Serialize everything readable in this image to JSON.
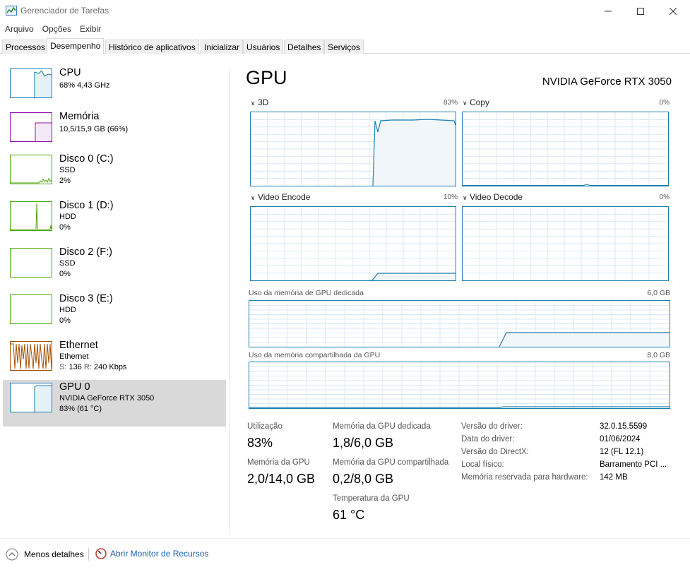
{
  "window": {
    "title": "Gerenciador de Tarefas"
  },
  "menu": [
    "Arquivo",
    "Opções",
    "Exibir"
  ],
  "tabs": [
    "Processos",
    "Desempenho",
    "Histórico de aplicativos",
    "Inicializar",
    "Usuários",
    "Detalhes",
    "Serviços"
  ],
  "sidebar": {
    "items": [
      {
        "name": "CPU",
        "line1": "68% 4,43 GHz",
        "line2": "",
        "color": "#1a7eb0"
      },
      {
        "name": "Memória",
        "line1": "10,5/15,9 GB (66%)",
        "line2": "",
        "color": "#8b12ae"
      },
      {
        "name": "Disco 0 (C:)",
        "line1": "SSD",
        "line2": "2%",
        "color": "#4da60c"
      },
      {
        "name": "Disco 1 (D:)",
        "line1": "HDD",
        "line2": "0%",
        "color": "#4da60c"
      },
      {
        "name": "Disco 2 (F:)",
        "line1": "SSD",
        "line2": "0%",
        "color": "#4da60c"
      },
      {
        "name": "Disco 3 (E:)",
        "line1": "HDD",
        "line2": "0%",
        "color": "#4da60c"
      },
      {
        "name": "Ethernet",
        "line1": "Ethernet",
        "line2_s_label": "S:",
        "line2_s_value": "136",
        "line2_r_label": "R:",
        "line2_r_value": "240 Kbps",
        "color": "#a74f01"
      },
      {
        "name": "GPU 0",
        "line1": "NVIDIA GeForce RTX 3050",
        "line2": "83% (61 °C)",
        "color": "#1a7eb0"
      }
    ]
  },
  "gpu": {
    "title": "GPU",
    "model": "NVIDIA GeForce RTX 3050",
    "engines": [
      {
        "label": "3D",
        "pct": "83%",
        "level": 0.83
      },
      {
        "label": "Copy",
        "pct": "0%",
        "level": 0.0
      },
      {
        "label": "Video Encode",
        "pct": "10%",
        "level": 0.1
      },
      {
        "label": "Video Decode",
        "pct": "0%",
        "level": 0.0
      }
    ],
    "dedicated_mem_label": "Uso da memória de GPU dedicada",
    "dedicated_mem_max": "6,0 GB",
    "shared_mem_label": "Uso da memória compartilhada da GPU",
    "shared_mem_max": "8,0 GB",
    "stats": {
      "utilization_label": "Utilização",
      "utilization_value": "83%",
      "gpu_memory_label": "Memória da GPU",
      "gpu_memory_value": "2,0/14,0 GB",
      "dedicated_label": "Memória da GPU dedicada",
      "dedicated_value": "1,8/6,0 GB",
      "shared_label": "Memória da GPU compartilhada",
      "shared_value": "0,2/8,0 GB",
      "temp_label": "Temperatura da GPU",
      "temp_value": "61 °C"
    },
    "info": [
      {
        "label": "Versão do driver:",
        "value": "32.0.15.5599"
      },
      {
        "label": "Data do driver:",
        "value": "01/06/2024"
      },
      {
        "label": "Versão do DirectX:",
        "value": "12 (FL 12.1)"
      },
      {
        "label": "Local físico:",
        "value": "Barramento PCI ..."
      },
      {
        "label": "Memória reservada para hardware:",
        "value": "142 MB"
      }
    ]
  },
  "footer": {
    "less_details": "Menos detalhes",
    "resource_monitor": "Abrir Monitor de Recursos"
  },
  "colors": {
    "gpu_line": "#1c7fb1",
    "gpu_fill": "#f1f6fa",
    "grid": "#d9eaf4",
    "selected": "#d9d9d9"
  }
}
